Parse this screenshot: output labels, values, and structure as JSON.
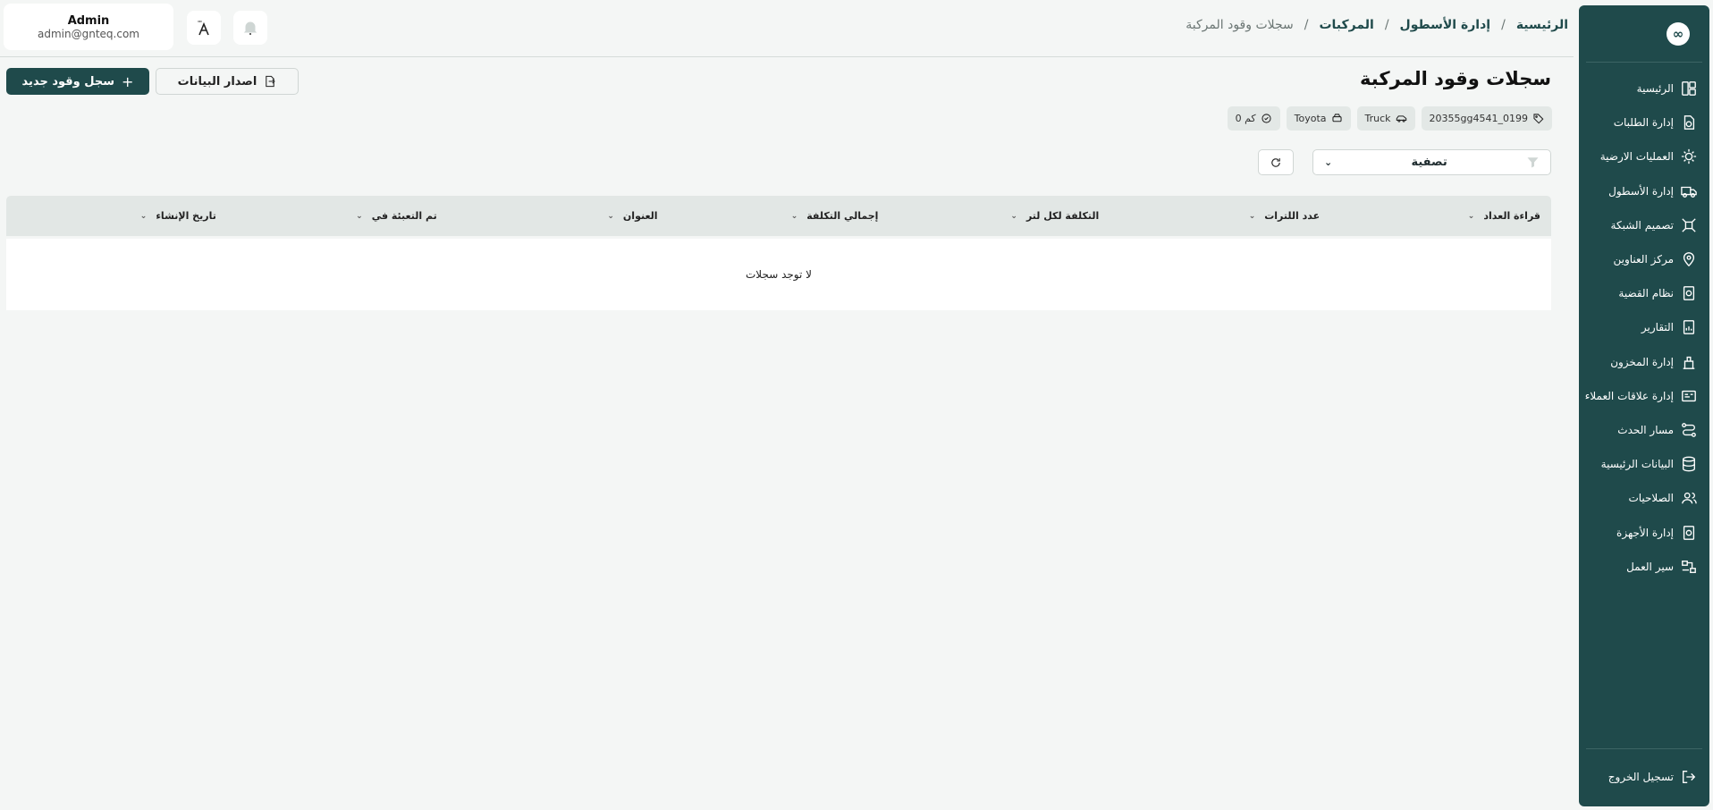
{
  "sidebar": {
    "items": [
      {
        "label": "الرئيسية",
        "icon": "dashboard-icon"
      },
      {
        "label": "إدارة الطلبات",
        "icon": "orders-icon"
      },
      {
        "label": "العمليات الارضية",
        "icon": "ground-ops-icon"
      },
      {
        "label": "إدارة الأسطول",
        "icon": "truck-icon"
      },
      {
        "label": "تصميم الشبكة",
        "icon": "network-icon"
      },
      {
        "label": "مركز العناوين",
        "icon": "location-icon"
      },
      {
        "label": "نظام القضية",
        "icon": "case-icon"
      },
      {
        "label": "التقارير",
        "icon": "report-icon"
      },
      {
        "label": "إدارة المخزون",
        "icon": "inventory-icon"
      },
      {
        "label": "إدارة علاقات العملاء",
        "icon": "crm-icon"
      },
      {
        "label": "مسار الحدث",
        "icon": "event-path-icon"
      },
      {
        "label": "البيانات الرئيسية",
        "icon": "database-icon"
      },
      {
        "label": "الصلاحيات",
        "icon": "users-icon"
      },
      {
        "label": "إدارة الأجهزة",
        "icon": "device-icon"
      },
      {
        "label": "سير العمل",
        "icon": "workflow-icon"
      }
    ],
    "logout_label": "تسجيل الخروج"
  },
  "breadcrumb": {
    "home": "الرئيسية",
    "fleet": "إدارة الأسطول",
    "vehicles": "المركبات",
    "current": "سجلات وقود المركبة",
    "separator": "/"
  },
  "user": {
    "name": "Admin",
    "email": "admin@gnteq.com"
  },
  "page": {
    "title": "سجلات وقود المركبة",
    "new_button": "سجل وقود جديد",
    "export_button": "اصدار البيانات"
  },
  "chips": {
    "plate": "20355gg4541_0199",
    "type": "Truck",
    "brand": "Toyota",
    "distance": "0 كم"
  },
  "filter": {
    "label": "تصفية"
  },
  "table": {
    "columns": [
      "قراءة العداد",
      "عدد اللترات",
      "التكلفة لكل لتر",
      "إجمالي التكلفة",
      "العنوان",
      "تم التعبئة في",
      "تاريخ الإنشاء"
    ],
    "empty_text": "لا توجد سجلات"
  },
  "colors": {
    "primary": "#1f4a4b",
    "background": "#f4f6f5",
    "header_row": "#e2e7e5"
  }
}
